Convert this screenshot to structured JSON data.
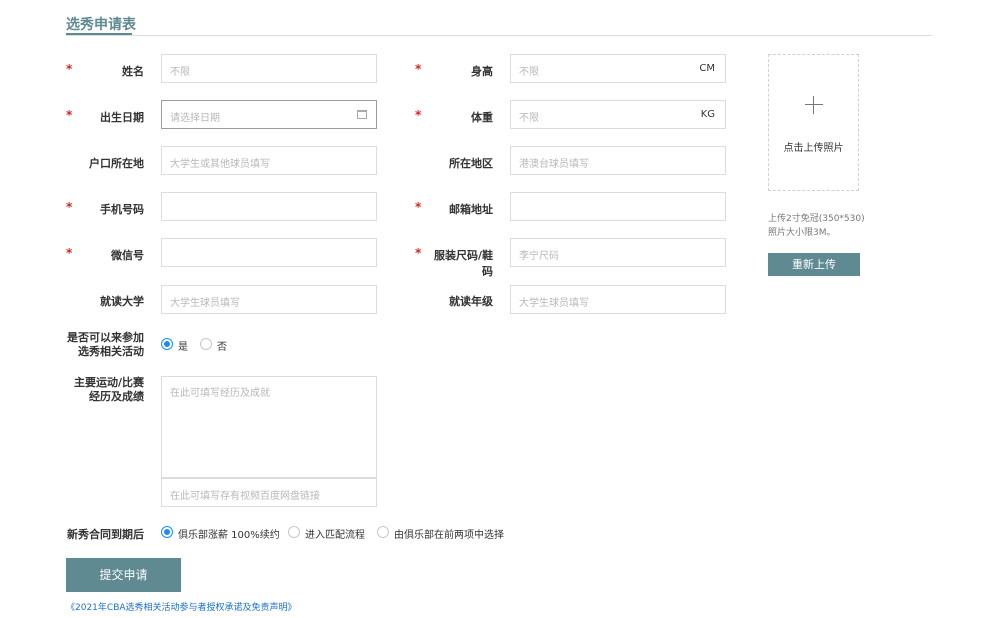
{
  "title": "选秀申请表",
  "required_mark": "*",
  "fields": {
    "name": {
      "label": "姓名",
      "placeholder": "不限"
    },
    "height": {
      "label": "身高",
      "placeholder": "不限",
      "unit": "CM"
    },
    "birthdate": {
      "label": "出生日期",
      "placeholder": "请选择日期"
    },
    "weight": {
      "label": "体重",
      "placeholder": "不限",
      "unit": "KG"
    },
    "hukou": {
      "label": "户口所在地",
      "placeholder": "大学生或其他球员填写"
    },
    "region": {
      "label": "所在地区",
      "placeholder": "港澳台球员填写"
    },
    "phone": {
      "label": "手机号码",
      "placeholder": ""
    },
    "email": {
      "label": "邮箱地址",
      "placeholder": ""
    },
    "wechat": {
      "label": "微信号",
      "placeholder": ""
    },
    "size": {
      "label": "服装尺码/鞋码",
      "placeholder": "李宁尺码"
    },
    "university": {
      "label": "就读大学",
      "placeholder": "大学生球员填写"
    },
    "grade": {
      "label": "就读年级",
      "placeholder": "大学生球员填写"
    }
  },
  "participate": {
    "label_line1": "是否可以来参加",
    "label_line2": "选秀相关活动",
    "options": [
      "是",
      "否"
    ],
    "selected": "是"
  },
  "experience": {
    "label_line1": "主要运动/比赛",
    "label_line2": "经历及成绩",
    "placeholder": "在此可填写经历及成就",
    "link_placeholder": "在此可填写存有视频百度网盘链接"
  },
  "contract": {
    "label": "新秀合同到期后",
    "options": [
      "俱乐部涨薪 100%续约",
      "进入匹配流程",
      "由俱乐部在前两项中选择"
    ],
    "selected": "俱乐部涨薪 100%续约"
  },
  "photo": {
    "upload_text": "点击上传照片",
    "hint_line1": "上传2寸免冠(350*530)",
    "hint_line2": "照片大小限3M。",
    "reupload_label": "重新上传"
  },
  "submit_label": "提交申请",
  "agreement_link": "《2021年CBA选秀相关活动参与者授权承诺及免责声明》"
}
